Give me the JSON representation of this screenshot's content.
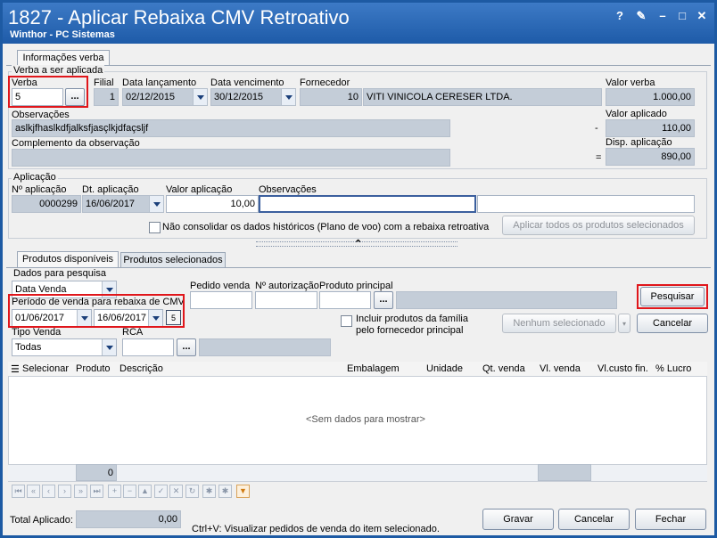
{
  "window": {
    "title": "1827 - Aplicar Rebaixa CMV Retroativo",
    "subtitle": "Winthor - PC Sistemas",
    "controls": [
      "?",
      "✎",
      "–",
      "□",
      "✕"
    ]
  },
  "main_tab": "Informações verba",
  "verba_section": {
    "legend": "Verba a ser aplicada",
    "verba_label": "Verba",
    "verba_value": "5",
    "browse_label": "...",
    "filial_label": "Filial",
    "filial_value": "1",
    "data_lancamento_label": "Data lançamento",
    "data_lancamento_value": "02/12/2015",
    "data_vencimento_label": "Data vencimento",
    "data_vencimento_value": "30/12/2015",
    "fornecedor_label": "Fornecedor",
    "fornecedor_code": "10",
    "fornecedor_name": "VITI VINICOLA CERESER LTDA.",
    "valor_verba_label": "Valor verba",
    "valor_verba_value": "1.000,00",
    "observacoes_label": "Observações",
    "observacoes_value": "aslkjfhaslkdfjalksfjasçlkjdfaçsljf",
    "minus_sign": "-",
    "valor_aplicado_label": "Valor aplicado",
    "valor_aplicado_value": "110,00",
    "complemento_label": "Complemento da observação",
    "complemento_value": "",
    "equals_sign": "=",
    "disp_aplicacao_label": "Disp. aplicação",
    "disp_aplicacao_value": "890,00"
  },
  "aplicacao_section": {
    "legend": "Aplicação",
    "n_aplicacao_label": "Nº aplicação",
    "n_aplicacao_value": "0000299",
    "dt_aplicacao_label": "Dt. aplicação",
    "dt_aplicacao_value": "16/06/2017",
    "valor_aplicacao_label": "Valor aplicação",
    "valor_aplicacao_value": "10,00",
    "observacoes_label": "Observações",
    "observacoes_value": "",
    "nao_consolidar_label": "Não consolidar os dados históricos (Plano de voo) com a rebaixa retroativa",
    "aplicar_todos_label": "Aplicar todos os produtos selecionados"
  },
  "product_tabs": [
    "Produtos disponíveis",
    "Produtos selecionados"
  ],
  "search": {
    "legend": "Dados para pesquisa",
    "tipo_data_value": "Data Venda",
    "periodo_label": "Período de venda para rebaixa de CMV",
    "data_inicio": "01/06/2017",
    "data_fim": "16/06/2017",
    "calendar_badge": "5",
    "tipo_venda_label": "Tipo Venda",
    "tipo_venda_value": "Todas",
    "rca_label": "RCA",
    "rca_value": "",
    "pedido_venda_label": "Pedido venda",
    "n_autorizacao_label": "Nº autorização",
    "produto_principal_label": "Produto principal",
    "incluir_label_line1": "Incluir produtos da família",
    "incluir_label_line2": "pelo fornecedor principal",
    "nenhum_selecionado": "Nenhum selecionado",
    "pesquisar_label": "Pesquisar",
    "cancelar_label": "Cancelar"
  },
  "grid": {
    "columns": [
      "Selecionar",
      "Produto",
      "Descrição",
      "Embalagem",
      "Unidade",
      "Qt. venda",
      "Vl. venda",
      "Vl.custo fin.",
      "% Lucro"
    ],
    "empty_text": "<Sem dados para mostrar>",
    "footer_count": "0"
  },
  "footer": {
    "total_aplicado_label": "Total Aplicado:",
    "total_aplicado_value": "0,00",
    "hint": "Ctrl+V: Visualizar pedidos de venda do item selecionado.",
    "gravar_label": "Gravar",
    "cancelar_label": "Cancelar",
    "fechar_label": "Fechar"
  },
  "colors": {
    "title_bar": "#1e5ba8",
    "highlight": "#e0161b",
    "readonly_field": "#c4cdd8"
  }
}
